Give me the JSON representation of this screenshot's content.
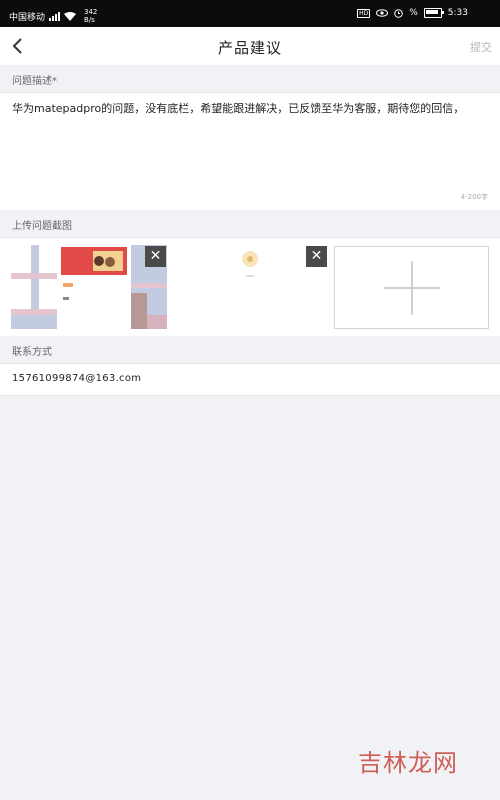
{
  "status_bar": {
    "carrier": "中国移动",
    "net_speed_value": "342",
    "net_speed_unit": "B/s",
    "hd_label": "HD",
    "battery_text": "%",
    "time": "5:33"
  },
  "header": {
    "title": "产品建议",
    "submit_label": "提交"
  },
  "problem": {
    "section_label": "问题描述*",
    "description": "华为matepadpro的问题，没有底栏，希望能跟进解决，已反馈至华为客服，期待您的回信，",
    "char_count": "4-200字"
  },
  "screenshots": {
    "section_label": "上传问题截图",
    "close_glyph": "✕"
  },
  "contact": {
    "section_label": "联系方式",
    "value": "15761099874@163.com"
  },
  "watermark": "吉林龙网",
  "colors": {
    "status_bar_bg": "#0c0c0c",
    "page_bg": "#f1f2f5",
    "watermark": "#c9453b"
  },
  "icons": {
    "back": "chevron-left-icon",
    "close": "close-icon",
    "add": "plus-icon"
  }
}
